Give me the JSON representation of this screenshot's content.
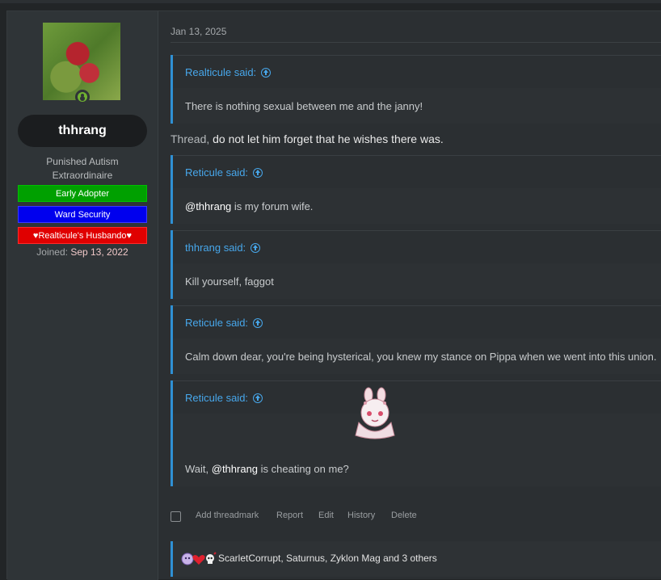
{
  "user": {
    "username": "thhrang",
    "title_line1": "Punished Autism",
    "title_line2": "Extraordinaire",
    "banners": [
      "Early Adopter",
      "Ward Security",
      "♥Realticule's Husbando♥"
    ],
    "joined_label": "Joined:",
    "joined_date": "Sep 13, 2022",
    "status": "online"
  },
  "post": {
    "date": "Jan 13, 2025",
    "quotes": [
      {
        "author": "Realticule said:",
        "body": "There is nothing sexual between me and the janny!"
      },
      {
        "author": "Reticule said:",
        "mention": "@thhrang",
        "body_rest": " is my forum wife."
      },
      {
        "author": "thhrang said:",
        "body": "Kill yourself, faggot"
      },
      {
        "author": "Reticule said:",
        "body": "Calm down dear, you're being hysterical, you knew my stance on Pippa when we went into this union."
      },
      {
        "author": "Reticule said:",
        "body_pre": "Wait, ",
        "mention": "@thhrang",
        "body_rest": " is cheating on me?"
      }
    ],
    "reply_prefix": "Thread,",
    "reply_text": " do not let him forget that he wishes there was."
  },
  "actions": {
    "add_threadmark": "Add threadmark",
    "report": "Report",
    "edit": "Edit",
    "history": "History",
    "delete": "Delete"
  },
  "reactions": {
    "text": "ScarletCorrupt, Saturnus, Zyklon Mag and 3 others",
    "icons": [
      "anime-face-icon",
      "heart-icon",
      "skull-icon"
    ]
  },
  "colors": {
    "accent": "#2f90d4",
    "link": "#47a7eb",
    "banner_green": "#00a000",
    "banner_blue": "#0000ee",
    "banner_red": "#e00000",
    "online": "#6fb131"
  }
}
